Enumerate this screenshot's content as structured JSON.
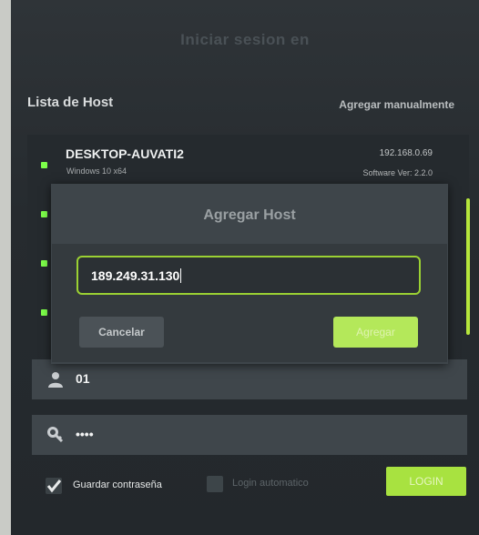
{
  "header": {
    "title": "Iniciar sesion en"
  },
  "host_list": {
    "title": "Lista de Host",
    "add_manual": "Agregar manualmente",
    "hosts": [
      {
        "name": "DESKTOP-AUVATI2",
        "os": "Windows 10 x64",
        "ip": "192.168.0.69",
        "version": "Software Ver: 2.2.0"
      }
    ]
  },
  "modal": {
    "title": "Agregar Host",
    "input_value": "189.249.31.130",
    "cancel_label": "Cancelar",
    "add_label": "Agregar"
  },
  "login": {
    "user_value": "01",
    "password_mask": "••••",
    "save_password_label": "Guardar contraseña",
    "save_password_checked": true,
    "auto_login_label": "Login automatico",
    "auto_login_checked": false,
    "login_label": "LOGIN"
  },
  "colors": {
    "accent": "#a8e240",
    "online": "#7dff4a",
    "background": "#2a2f33"
  },
  "icons": {
    "user": "user-icon",
    "password": "key-icon"
  }
}
